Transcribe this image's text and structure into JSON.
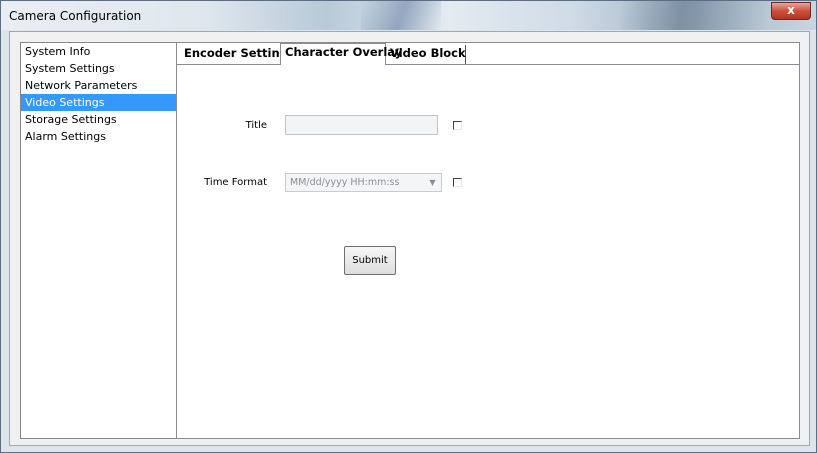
{
  "window": {
    "title": "Camera Configuration",
    "close_label": "x"
  },
  "nav": {
    "items": [
      {
        "label": "System Info"
      },
      {
        "label": "System Settings"
      },
      {
        "label": "Network Parameters"
      },
      {
        "label": "Video Settings",
        "selected": true
      },
      {
        "label": "Storage Settings"
      },
      {
        "label": "Alarm Settings"
      }
    ]
  },
  "tabs": [
    {
      "label": "Encoder Settings"
    },
    {
      "label": "Character Overlay",
      "active": true
    },
    {
      "label": "Video Block"
    }
  ],
  "form": {
    "title_label": "Title",
    "title_value": "",
    "title_checked": false,
    "time_format_label": "Time Format",
    "time_format_value": "MM/dd/yyyy HH:mm:ss",
    "time_format_checked": false,
    "submit_label": "Submit"
  }
}
